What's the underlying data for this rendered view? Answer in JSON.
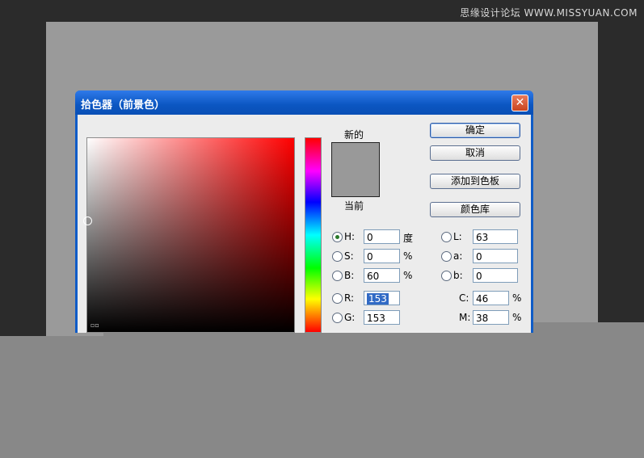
{
  "watermark": "思缘设计论坛 WWW.MISSYUAN.COM",
  "dialog": {
    "title": "拾色器（前景色）",
    "close_glyph": "✕",
    "new_label": "新的",
    "current_label": "当前",
    "buttons": {
      "ok": "确定",
      "cancel": "取消",
      "add_swatch": "添加到色板",
      "libraries": "颜色库"
    },
    "hsb": {
      "h": {
        "label": "H:",
        "value": "0",
        "unit": "度"
      },
      "s": {
        "label": "S:",
        "value": "0",
        "unit": "%"
      },
      "b": {
        "label": "B:",
        "value": "60",
        "unit": "%"
      }
    },
    "lab": {
      "l": {
        "label": "L:",
        "value": "63"
      },
      "a": {
        "label": "a:",
        "value": "0"
      },
      "b": {
        "label": "b:",
        "value": "0"
      }
    },
    "rgb": {
      "r": {
        "label": "R:",
        "value": "153"
      },
      "g": {
        "label": "G:",
        "value": "153"
      }
    },
    "cmyk": {
      "c": {
        "label": "C:",
        "value": "46",
        "unit": "%"
      },
      "m": {
        "label": "M:",
        "value": "38",
        "unit": "%"
      }
    },
    "corner_mark": "▫▫",
    "colors": {
      "new": "#999999",
      "current": "#999999"
    }
  }
}
